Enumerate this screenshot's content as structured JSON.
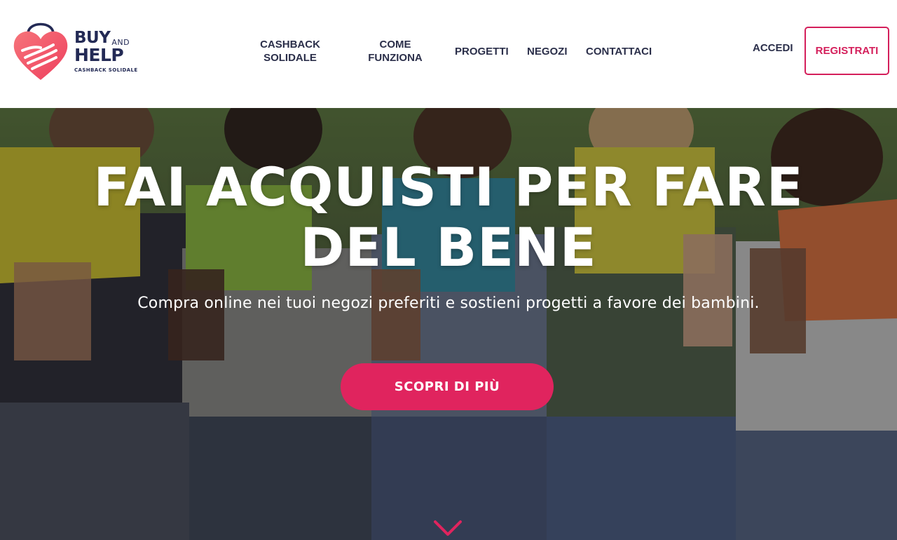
{
  "brand": {
    "name_top": "BUY",
    "name_and": "AND",
    "name_bottom": "HELP",
    "tagline": "CASHBACK SOLIDALE",
    "icon": "heart-hand-logo-icon",
    "color_primary": "#232a55",
    "color_accent": "#f25a6b"
  },
  "nav": {
    "items": [
      {
        "label": "CASHBACK SOLIDALE"
      },
      {
        "label": "COME FUNZIONA"
      },
      {
        "label": "PROGETTI"
      },
      {
        "label": "NEGOZI"
      },
      {
        "label": "CONTATTACI"
      }
    ],
    "login_label": "ACCEDI",
    "register_label": "REGISTRATI"
  },
  "hero": {
    "title": "FAI ACQUISTI PER FARE DEL BENE",
    "subtitle": "Compra online nei tuoi negozi preferiti e sostieni progetti a favore dei bambini.",
    "cta_label": "SCOPRI DI PIÙ",
    "scroll_icon": "chevron-down-icon",
    "accent_color": "#e0245e"
  }
}
